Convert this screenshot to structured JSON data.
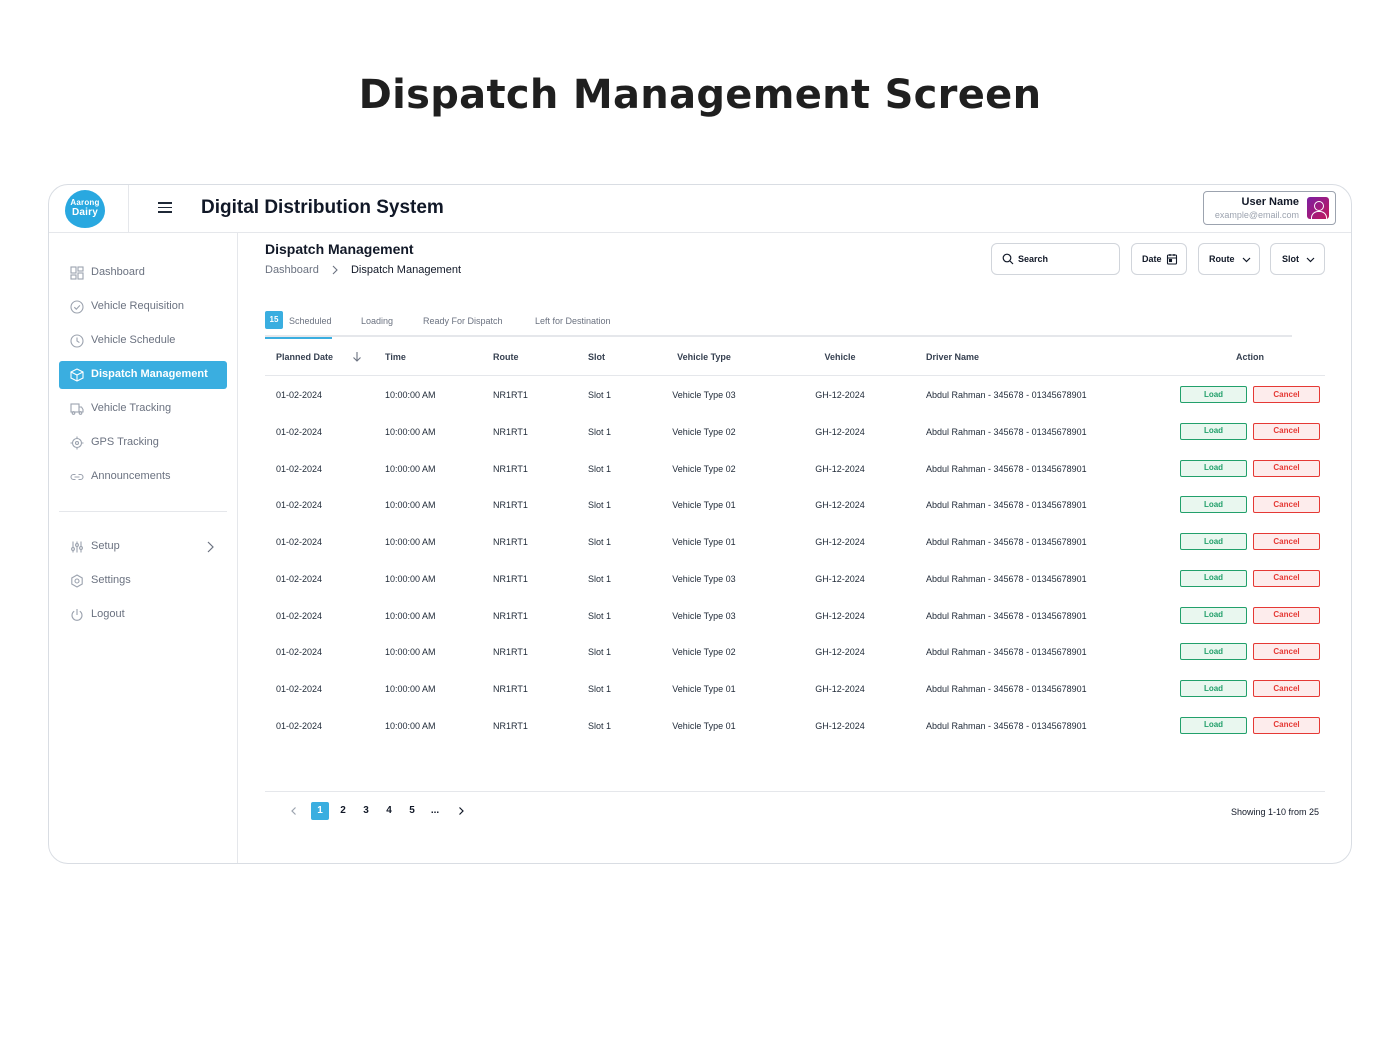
{
  "page_title": "Dispatch Management Screen",
  "app": {
    "logo_line1": "Aarong",
    "logo_line2": "Dairy",
    "name": "Digital Distribution System"
  },
  "user": {
    "name": "User Name",
    "email": "example@email.com"
  },
  "sidebar": {
    "items": [
      {
        "label": "Dashboard",
        "icon": "grid-icon",
        "active": false
      },
      {
        "label": "Vehicle Requisition",
        "icon": "check-circle-icon",
        "active": false
      },
      {
        "label": "Vehicle Schedule",
        "icon": "clock-icon",
        "active": false
      },
      {
        "label": "Dispatch Management",
        "icon": "box-icon",
        "active": true
      },
      {
        "label": "Vehicle Tracking",
        "icon": "truck-icon",
        "active": false
      },
      {
        "label": "GPS Tracking",
        "icon": "crosshair-icon",
        "active": false
      },
      {
        "label": "Announcements",
        "icon": "link-icon",
        "active": false
      }
    ],
    "secondary": [
      {
        "label": "Setup",
        "icon": "sliders-icon"
      },
      {
        "label": "Settings",
        "icon": "gear-icon"
      },
      {
        "label": "Logout",
        "icon": "power-icon"
      }
    ]
  },
  "main": {
    "title": "Dispatch Management",
    "breadcrumb": [
      "Dashboard",
      "Dispatch Management"
    ],
    "search_placeholder": "Search",
    "filters": {
      "date": "Date",
      "route": "Route",
      "slot": "Slot"
    },
    "tabs": [
      {
        "label": "Scheduled",
        "badge": "15",
        "active": true
      },
      {
        "label": "Loading",
        "badge": "",
        "active": false
      },
      {
        "label": "Ready For Dispatch",
        "badge": "",
        "active": false
      },
      {
        "label": "Left for Destination",
        "badge": "",
        "active": false
      }
    ],
    "table": {
      "columns": [
        "Planned Date",
        "Time",
        "Route",
        "Slot",
        "Vehicle Type",
        "Vehicle",
        "Driver Name",
        "Action"
      ],
      "load_label": "Load",
      "cancel_label": "Cancel",
      "rows": [
        [
          "01-02-2024",
          "10:00:00 AM",
          "NR1RT1",
          "Slot 1",
          "Vehicle Type 03",
          "GH-12-2024",
          "Abdul Rahman - 345678 - 01345678901"
        ],
        [
          "01-02-2024",
          "10:00:00 AM",
          "NR1RT1",
          "Slot 1",
          "Vehicle Type 02",
          "GH-12-2024",
          "Abdul Rahman - 345678 - 01345678901"
        ],
        [
          "01-02-2024",
          "10:00:00 AM",
          "NR1RT1",
          "Slot 1",
          "Vehicle Type 02",
          "GH-12-2024",
          "Abdul Rahman - 345678 - 01345678901"
        ],
        [
          "01-02-2024",
          "10:00:00 AM",
          "NR1RT1",
          "Slot 1",
          "Vehicle Type 01",
          "GH-12-2024",
          "Abdul Rahman - 345678 - 01345678901"
        ],
        [
          "01-02-2024",
          "10:00:00 AM",
          "NR1RT1",
          "Slot 1",
          "Vehicle Type 01",
          "GH-12-2024",
          "Abdul Rahman - 345678 - 01345678901"
        ],
        [
          "01-02-2024",
          "10:00:00 AM",
          "NR1RT1",
          "Slot 1",
          "Vehicle Type 03",
          "GH-12-2024",
          "Abdul Rahman - 345678 - 01345678901"
        ],
        [
          "01-02-2024",
          "10:00:00 AM",
          "NR1RT1",
          "Slot 1",
          "Vehicle Type 03",
          "GH-12-2024",
          "Abdul Rahman - 345678 - 01345678901"
        ],
        [
          "01-02-2024",
          "10:00:00 AM",
          "NR1RT1",
          "Slot 1",
          "Vehicle Type 02",
          "GH-12-2024",
          "Abdul Rahman - 345678 - 01345678901"
        ],
        [
          "01-02-2024",
          "10:00:00 AM",
          "NR1RT1",
          "Slot 1",
          "Vehicle Type 01",
          "GH-12-2024",
          "Abdul Rahman - 345678 - 01345678901"
        ],
        [
          "01-02-2024",
          "10:00:00 AM",
          "NR1RT1",
          "Slot 1",
          "Vehicle Type 01",
          "GH-12-2024",
          "Abdul Rahman - 345678 - 01345678901"
        ]
      ]
    },
    "pagination": {
      "pages": [
        "1",
        "2",
        "3",
        "4",
        "5",
        "..."
      ],
      "current": "1",
      "showing": "Showing 1-10 from 25"
    }
  },
  "colors": {
    "accent": "#3aaee0",
    "load": "#22a06b",
    "cancel": "#e53935"
  }
}
